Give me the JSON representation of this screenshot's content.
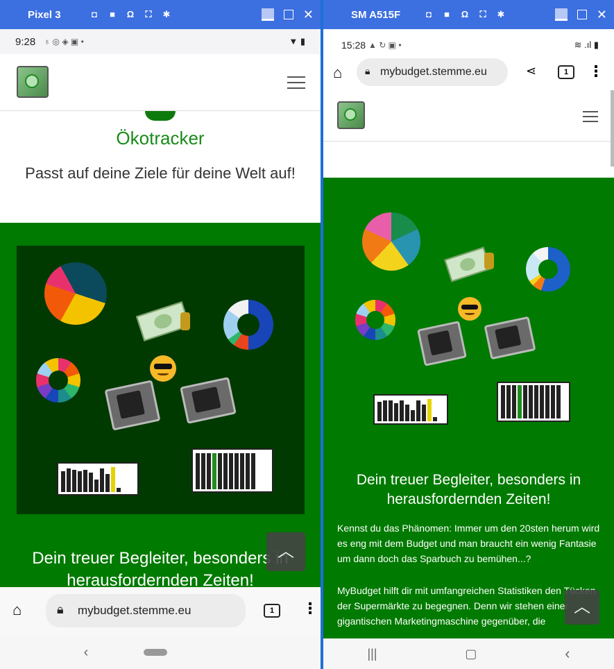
{
  "left": {
    "window_title": "Pixel 3",
    "status": {
      "time": "9:28"
    },
    "hero": {
      "title": "Ökotracker",
      "subtitle": "Passt auf deine Ziele für deine Welt auf!"
    },
    "green_heading": "Dein treuer Begleiter, besonders in herausfordernden Zeiten!",
    "address": "mybudget.stemme.eu",
    "tab_count": "1",
    "scroll_top": "︿"
  },
  "right": {
    "window_title": "SM A515F",
    "status": {
      "time": "15:28"
    },
    "address": "mybudget.stemme.eu",
    "tab_count": "1",
    "green_heading": "Dein treuer Begleiter, besonders in herausfordernden Zeiten!",
    "para1": "Kennst du das Phänomen: Immer um den 20sten herum wird es eng mit dem Budget und man braucht ein wenig Fantasie um dann doch das Sparbuch zu bemühen...?",
    "para2": "MyBudget hilft dir mit umfangreichen Statistiken den Tücken der Supermärkte zu begegnen. Denn wir stehen einer gigantischen Marketingmaschine gegenüber, die",
    "scroll_top": "︿"
  },
  "colors": {
    "brand_green": "#007a00",
    "dark_green": "#003a00",
    "emu_blue": "#3c6fe0"
  }
}
